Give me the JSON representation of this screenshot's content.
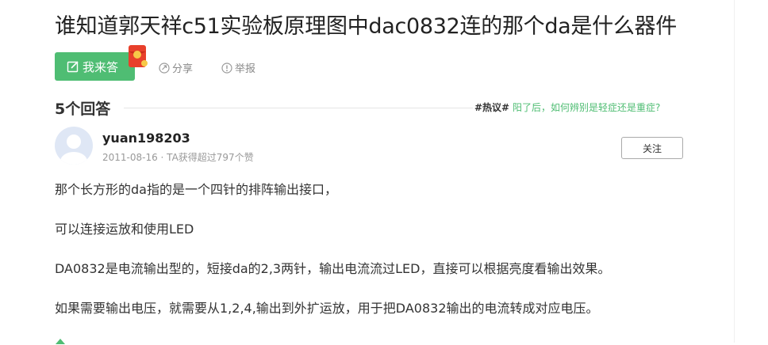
{
  "question": {
    "title": "谁知道郭天祥c51实验板原理图中dac0832连的那个da是什么器件"
  },
  "actions": {
    "answer_label": "我来答",
    "share_label": "分享",
    "report_label": "举报"
  },
  "answers_header": {
    "count_label": "5个回答"
  },
  "hot_topic": {
    "tag": "#热议#",
    "text": "阳了后，如何辨别是轻症还是重症?"
  },
  "answer": {
    "username": "yuan198203",
    "meta": "2011-08-16 · TA获得超过797个赞",
    "follow_label": "关注",
    "paragraphs": [
      "那个长方形的da指的是一个四针的排阵输出接口，",
      "可以连接运放和使用LED",
      "DA0832是电流输出型的，短接da的2,3两针，输出电流流过LED，直接可以根据亮度看输出效果。",
      "如果需要输出电压，就需要从1,2,4,输出到外扩运放，用于把DA0832输出的电流转成对应电压。"
    ]
  },
  "colors": {
    "accent": "#4fbd73",
    "title": "#222222",
    "muted": "#999999",
    "redpack": "#e8402b"
  }
}
